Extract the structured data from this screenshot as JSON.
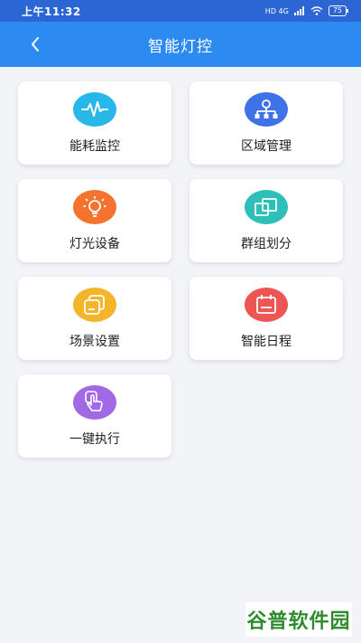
{
  "status_bar": {
    "time": "上午11:32",
    "network": "HD 4G",
    "battery": "75"
  },
  "header": {
    "title": "智能灯控"
  },
  "menu": [
    {
      "label": "能耗监控",
      "icon": "pulse-icon",
      "color": "#27b7e8"
    },
    {
      "label": "区域管理",
      "icon": "network-icon",
      "color": "#3f72e6"
    },
    {
      "label": "灯光设备",
      "icon": "lightbulb-icon",
      "color": "#f4742f"
    },
    {
      "label": "群组划分",
      "icon": "group-squares-icon",
      "color": "#2ebfb8"
    },
    {
      "label": "场景设置",
      "icon": "scene-layers-icon",
      "color": "#f5b52b"
    },
    {
      "label": "智能日程",
      "icon": "calendar-icon",
      "color": "#ee5656"
    },
    {
      "label": "一键执行",
      "icon": "tap-hand-icon",
      "color": "#a169e3"
    }
  ],
  "watermark": {
    "text": "谷普软件园"
  }
}
